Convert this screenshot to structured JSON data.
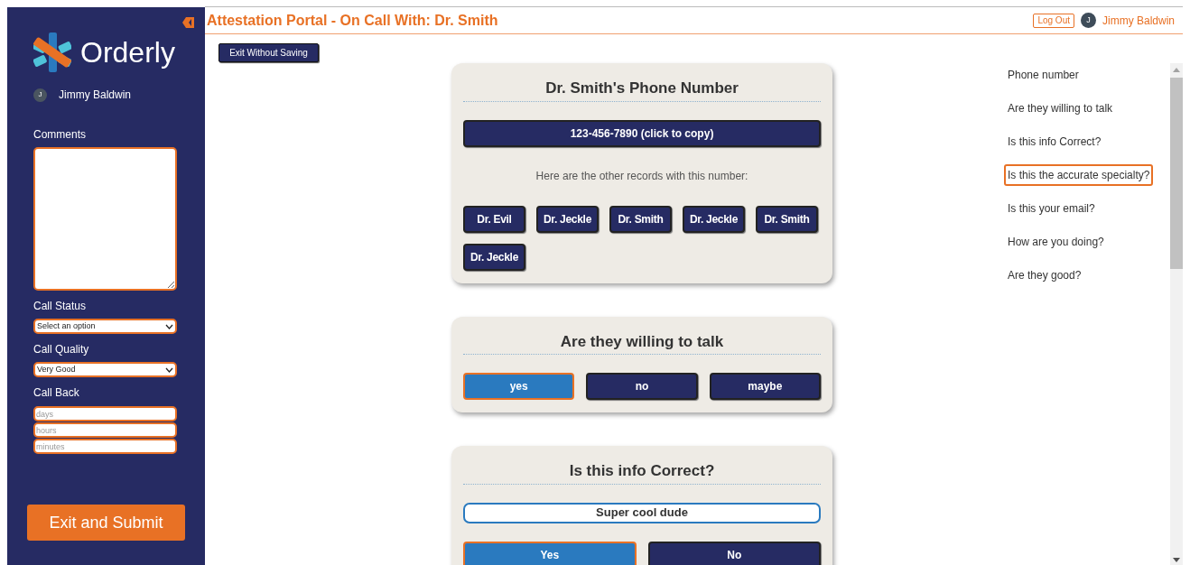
{
  "sidebar": {
    "logo_text": "Orderly",
    "user": {
      "initial": "J",
      "name": "Jimmy Baldwin"
    },
    "comments": {
      "label": "Comments"
    },
    "call_status": {
      "label": "Call Status",
      "value": "Select an option"
    },
    "call_quality": {
      "label": "Call Quality",
      "value": "Very Good"
    },
    "call_back": {
      "label": "Call Back",
      "fields": [
        {
          "placeholder": "days"
        },
        {
          "placeholder": "hours"
        },
        {
          "placeholder": "minutes"
        }
      ]
    },
    "submit_button": "Exit and Submit"
  },
  "header": {
    "title": "Attestation Portal - On Call With: Dr. Smith",
    "logout": "Log Out",
    "user": {
      "initial": "J",
      "name": "Jimmy Baldwin"
    }
  },
  "exit_button": "Exit Without Saving",
  "cards": [
    {
      "kind": "phone",
      "title": "Dr. Smith's Phone Number",
      "phone_button": "123-456-7890 (click to copy)",
      "note": "Here are the other records with this number:",
      "records": [
        "Dr. Evil",
        "Dr. Jeckle",
        "Dr. Smith",
        "Dr. Jeckle",
        "Dr. Smith",
        "Dr. Jeckle"
      ]
    },
    {
      "kind": "choice",
      "title": "Are they willing to talk",
      "options": [
        {
          "label": "yes",
          "selected": true
        },
        {
          "label": "no",
          "selected": false
        },
        {
          "label": "maybe",
          "selected": false
        }
      ]
    },
    {
      "kind": "info",
      "title": "Is this info Correct?",
      "value": "Super cool dude",
      "options": [
        {
          "label": "Yes",
          "selected": true
        },
        {
          "label": "No",
          "selected": false
        }
      ]
    }
  ],
  "nav": [
    {
      "label": "Phone number",
      "selected": false
    },
    {
      "label": "Are they willing to talk",
      "selected": false
    },
    {
      "label": "Is this info Correct?",
      "selected": false
    },
    {
      "label": "Is this the accurate specialty?",
      "selected": true
    },
    {
      "label": "Is this your email?",
      "selected": false
    },
    {
      "label": "How are you doing?",
      "selected": false
    },
    {
      "label": "Are they good?",
      "selected": false
    }
  ]
}
